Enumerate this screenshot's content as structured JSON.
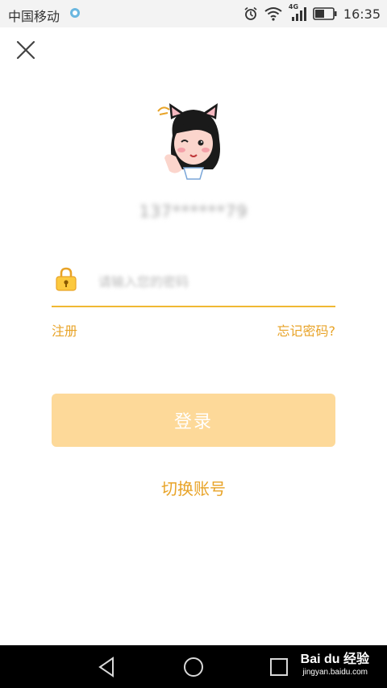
{
  "status_bar": {
    "carrier": "中国移动",
    "network": "4G",
    "time": "16:35"
  },
  "account": {
    "masked_phone": "137******79"
  },
  "password": {
    "placeholder": "请输入您的密码"
  },
  "links": {
    "register": "注册",
    "forgot_password": "忘记密码?"
  },
  "login_button": "登录",
  "switch_account": "切换账号",
  "watermark": {
    "brand": "Bai du 经验",
    "url": "jingyan.baidu.com"
  },
  "colors": {
    "accent": "#e8a327",
    "login_button_bg": "#fdd999",
    "underline": "#f0b833"
  },
  "icons": [
    "close-icon",
    "lock-icon",
    "back-icon",
    "home-icon",
    "recent-apps-icon"
  ]
}
